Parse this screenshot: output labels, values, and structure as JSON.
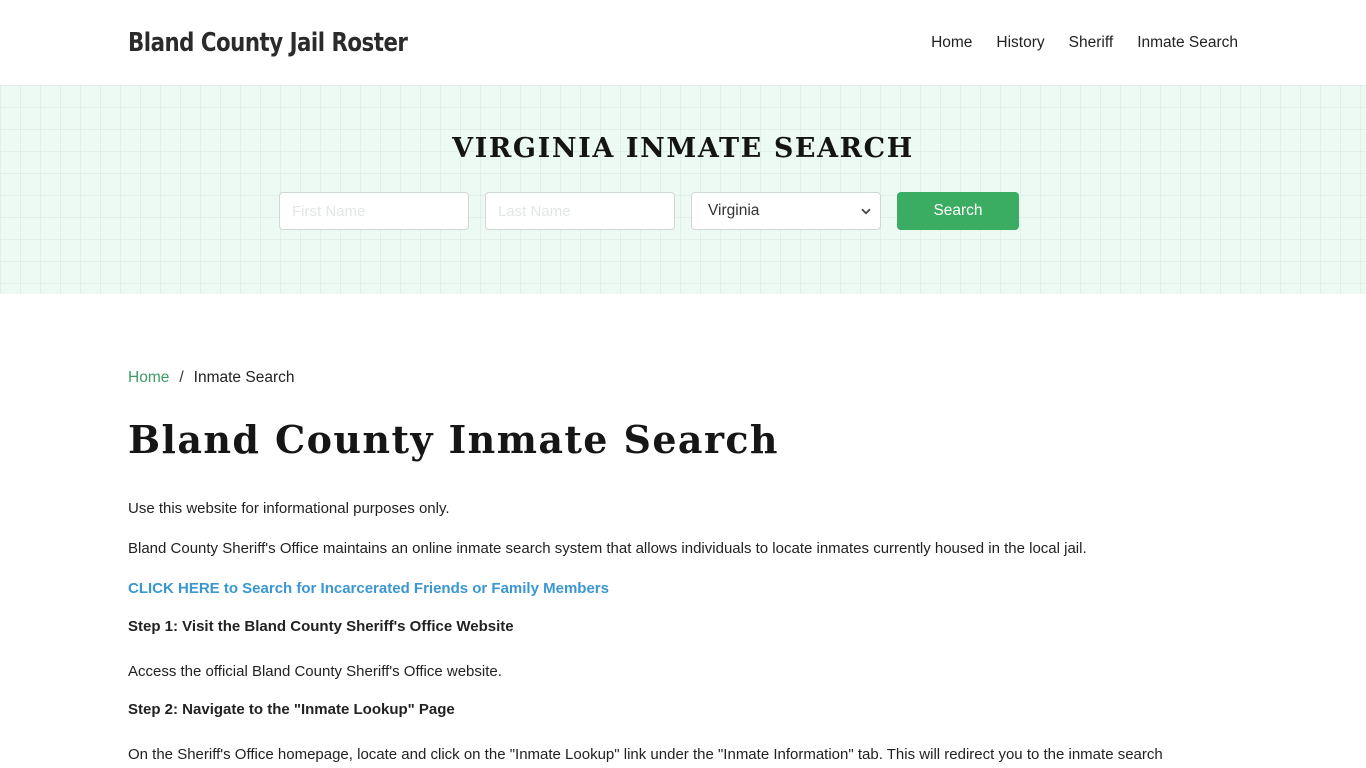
{
  "header": {
    "brand": "Bland County Jail Roster",
    "nav": [
      {
        "label": "Home"
      },
      {
        "label": "History"
      },
      {
        "label": "Sheriff"
      },
      {
        "label": "Inmate Search"
      }
    ]
  },
  "hero": {
    "title": "VIRGINIA INMATE SEARCH",
    "first_name_placeholder": "First Name",
    "last_name_placeholder": "Last Name",
    "first_name_value": "",
    "last_name_value": "",
    "state_selected": "Virginia",
    "search_label": "Search",
    "accent_color": "#3aad62"
  },
  "breadcrumb": {
    "home": "Home",
    "separator": "/",
    "current": "Inmate Search"
  },
  "main": {
    "title": "Bland County Inmate Search",
    "intro": "Use this website for informational purposes only.",
    "description": "Bland County Sheriff's Office maintains an online inmate search system that allows individuals to locate inmates currently housed in the local jail.",
    "cta_link": "CLICK HERE to Search for Incarcerated Friends or Family Members",
    "steps": [
      {
        "heading": "Step 1: Visit the Bland County Sheriff's Office Website",
        "text": "Access the official Bland County Sheriff's Office website."
      },
      {
        "heading": "Step 2: Navigate to the \"Inmate Lookup\" Page",
        "text": "On the Sheriff's Office homepage, locate and click on the \"Inmate Lookup\" link under the \"Inmate Information\" tab. This will redirect you to the inmate search"
      }
    ],
    "link_color": "#3b97cf"
  }
}
